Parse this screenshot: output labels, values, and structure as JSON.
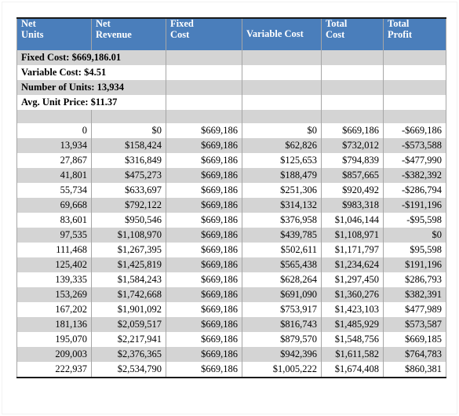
{
  "table": {
    "headers": [
      {
        "line1": "Net",
        "line2": "Units",
        "align": "top"
      },
      {
        "line1": "Net",
        "line2": "Revenue",
        "align": "top"
      },
      {
        "line1": "Fixed",
        "line2": "Cost",
        "align": "top"
      },
      {
        "line1": "Variable Cost",
        "line2": "",
        "align": "middle"
      },
      {
        "line1": "Total",
        "line2": "Cost",
        "align": "top"
      },
      {
        "line1": "Total",
        "line2": "Profit",
        "align": "top"
      }
    ],
    "summary": [
      {
        "label": "Fixed Cost: $669,186.01"
      },
      {
        "label": "Variable Cost: $4.51"
      },
      {
        "label": "Number of Units: 13,934"
      },
      {
        "label": "Avg. Unit Price: $11.37"
      }
    ],
    "rows": [
      {
        "net_units": "0",
        "net_revenue": "$0",
        "fixed_cost": "$669,186",
        "variable_cost": "$0",
        "total_cost": "$669,186",
        "total_profit": "-$669,186"
      },
      {
        "net_units": "13,934",
        "net_revenue": "$158,424",
        "fixed_cost": "$669,186",
        "variable_cost": "$62,826",
        "total_cost": "$732,012",
        "total_profit": "-$573,588"
      },
      {
        "net_units": "27,867",
        "net_revenue": "$316,849",
        "fixed_cost": "$669,186",
        "variable_cost": "$125,653",
        "total_cost": "$794,839",
        "total_profit": "-$477,990"
      },
      {
        "net_units": "41,801",
        "net_revenue": "$475,273",
        "fixed_cost": "$669,186",
        "variable_cost": "$188,479",
        "total_cost": "$857,665",
        "total_profit": "-$382,392"
      },
      {
        "net_units": "55,734",
        "net_revenue": "$633,697",
        "fixed_cost": "$669,186",
        "variable_cost": "$251,306",
        "total_cost": "$920,492",
        "total_profit": "-$286,794"
      },
      {
        "net_units": "69,668",
        "net_revenue": "$792,122",
        "fixed_cost": "$669,186",
        "variable_cost": "$314,132",
        "total_cost": "$983,318",
        "total_profit": "-$191,196"
      },
      {
        "net_units": "83,601",
        "net_revenue": "$950,546",
        "fixed_cost": "$669,186",
        "variable_cost": "$376,958",
        "total_cost": "$1,046,144",
        "total_profit": "-$95,598"
      },
      {
        "net_units": "97,535",
        "net_revenue": "$1,108,970",
        "fixed_cost": "$669,186",
        "variable_cost": "$439,785",
        "total_cost": "$1,108,971",
        "total_profit": "$0"
      },
      {
        "net_units": "111,468",
        "net_revenue": "$1,267,395",
        "fixed_cost": "$669,186",
        "variable_cost": "$502,611",
        "total_cost": "$1,171,797",
        "total_profit": "$95,598"
      },
      {
        "net_units": "125,402",
        "net_revenue": "$1,425,819",
        "fixed_cost": "$669,186",
        "variable_cost": "$565,438",
        "total_cost": "$1,234,624",
        "total_profit": "$191,196"
      },
      {
        "net_units": "139,335",
        "net_revenue": "$1,584,243",
        "fixed_cost": "$669,186",
        "variable_cost": "$628,264",
        "total_cost": "$1,297,450",
        "total_profit": "$286,793"
      },
      {
        "net_units": "153,269",
        "net_revenue": "$1,742,668",
        "fixed_cost": "$669,186",
        "variable_cost": "$691,090",
        "total_cost": "$1,360,276",
        "total_profit": "$382,391"
      },
      {
        "net_units": "167,202",
        "net_revenue": "$1,901,092",
        "fixed_cost": "$669,186",
        "variable_cost": "$753,917",
        "total_cost": "$1,423,103",
        "total_profit": "$477,989"
      },
      {
        "net_units": "181,136",
        "net_revenue": "$2,059,517",
        "fixed_cost": "$669,186",
        "variable_cost": "$816,743",
        "total_cost": "$1,485,929",
        "total_profit": "$573,587"
      },
      {
        "net_units": "195,070",
        "net_revenue": "$2,217,941",
        "fixed_cost": "$669,186",
        "variable_cost": "$879,570",
        "total_cost": "$1,548,756",
        "total_profit": "$669,185"
      },
      {
        "net_units": "209,003",
        "net_revenue": "$2,376,365",
        "fixed_cost": "$669,186",
        "variable_cost": "$942,396",
        "total_cost": "$1,611,582",
        "total_profit": "$764,783"
      },
      {
        "net_units": "222,937",
        "net_revenue": "$2,534,790",
        "fixed_cost": "$669,186",
        "variable_cost": "$1,005,222",
        "total_cost": "$1,674,408",
        "total_profit": "$860,381"
      }
    ]
  },
  "colors": {
    "header_blue": "#4a7ebb",
    "band_gray": "#d4d4d4",
    "row_white": "#ffffff",
    "text": "#000000"
  }
}
